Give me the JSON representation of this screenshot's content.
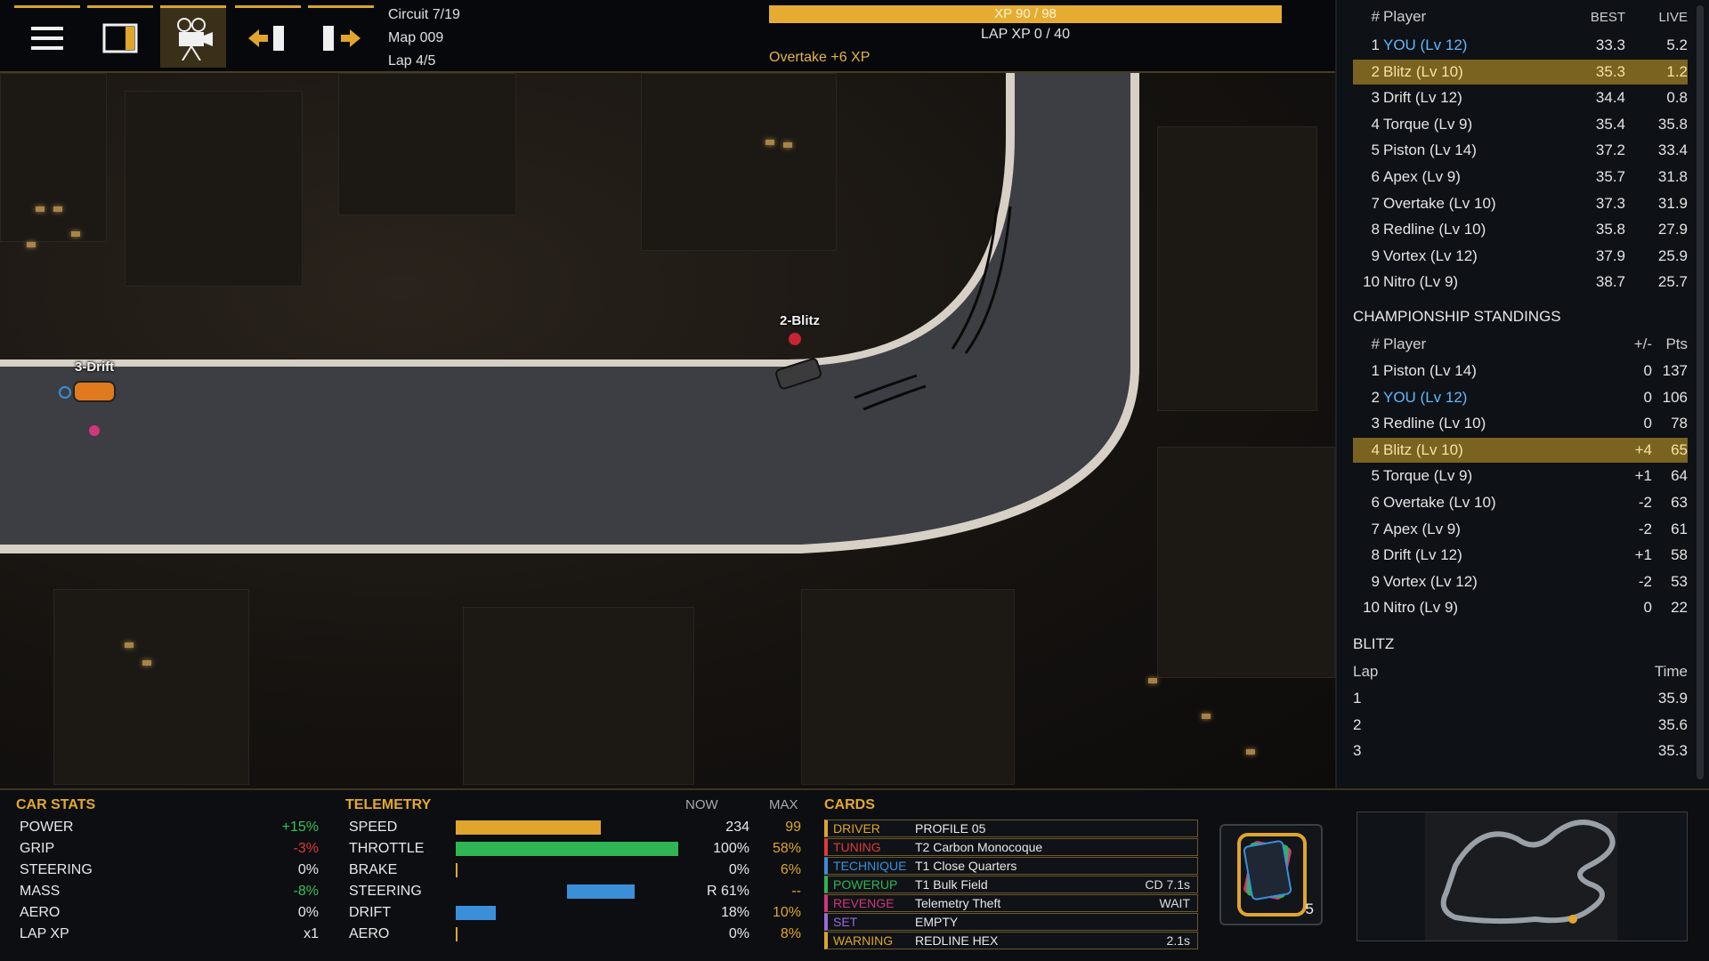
{
  "topbar": {
    "circuit": "Circuit 7/19",
    "map": "Map 009",
    "lap": "Lap 4/5",
    "xp_text": "XP 90 / 98",
    "lap_xp": "LAP XP 0 / 40",
    "event": "Overtake +6 XP",
    "buttons": [
      "menu-icon",
      "panel-toggle-icon",
      "camera-icon",
      "prev-icon",
      "next-icon"
    ]
  },
  "track_labels": {
    "blitz": "2-Blitz",
    "drift": "3-Drift"
  },
  "leaderboard": {
    "header": {
      "rank": "#",
      "player": "Player",
      "best": "BEST",
      "live": "LIVE"
    },
    "rows": [
      {
        "rank": "1",
        "name": "YOU (Lv 12)",
        "best": "33.3",
        "live": "5.2"
      },
      {
        "rank": "2",
        "name": "Blitz (Lv 10)",
        "best": "35.3",
        "live": "1.2"
      },
      {
        "rank": "3",
        "name": "Drift (Lv 12)",
        "best": "34.4",
        "live": "0.8"
      },
      {
        "rank": "4",
        "name": "Torque (Lv 9)",
        "best": "35.4",
        "live": "35.8"
      },
      {
        "rank": "5",
        "name": "Piston (Lv 14)",
        "best": "37.2",
        "live": "33.4"
      },
      {
        "rank": "6",
        "name": "Apex (Lv 9)",
        "best": "35.7",
        "live": "31.8"
      },
      {
        "rank": "7",
        "name": "Overtake (Lv 10)",
        "best": "37.3",
        "live": "31.9"
      },
      {
        "rank": "8",
        "name": "Redline (Lv 10)",
        "best": "35.8",
        "live": "27.9"
      },
      {
        "rank": "9",
        "name": "Vortex (Lv 12)",
        "best": "37.9",
        "live": "25.9"
      },
      {
        "rank": "10",
        "name": "Nitro (Lv 9)",
        "best": "38.7",
        "live": "25.7"
      }
    ]
  },
  "championship": {
    "title": "CHAMPIONSHIP STANDINGS",
    "header": {
      "rank": "#",
      "player": "Player",
      "delta": "+/-",
      "pts": "Pts"
    },
    "rows": [
      {
        "rank": "1",
        "name": "Piston (Lv 14)",
        "delta": "0",
        "pts": "137"
      },
      {
        "rank": "2",
        "name": "YOU (Lv 12)",
        "delta": "0",
        "pts": "106"
      },
      {
        "rank": "3",
        "name": "Redline (Lv 10)",
        "delta": "0",
        "pts": "78"
      },
      {
        "rank": "4",
        "name": "Blitz (Lv 10)",
        "delta": "+4",
        "pts": "65"
      },
      {
        "rank": "5",
        "name": "Torque (Lv 9)",
        "delta": "+1",
        "pts": "64"
      },
      {
        "rank": "6",
        "name": "Overtake (Lv 10)",
        "delta": "-2",
        "pts": "63"
      },
      {
        "rank": "7",
        "name": "Apex (Lv 9)",
        "delta": "-2",
        "pts": "61"
      },
      {
        "rank": "8",
        "name": "Drift (Lv 12)",
        "delta": "+1",
        "pts": "58"
      },
      {
        "rank": "9",
        "name": "Vortex (Lv 12)",
        "delta": "-2",
        "pts": "53"
      },
      {
        "rank": "10",
        "name": "Nitro (Lv 9)",
        "delta": "0",
        "pts": "22"
      }
    ]
  },
  "laps": {
    "title": "BLITZ",
    "header": {
      "lap": "Lap",
      "time": "Time"
    },
    "rows": [
      {
        "lap": "1",
        "time": "35.9"
      },
      {
        "lap": "2",
        "time": "35.6"
      },
      {
        "lap": "3",
        "time": "35.3"
      }
    ]
  },
  "car_stats": {
    "title": "CAR STATS",
    "rows": [
      {
        "label": "POWER",
        "value": "+15%",
        "tone": "green"
      },
      {
        "label": "GRIP",
        "value": "-3%",
        "tone": "red"
      },
      {
        "label": "STEERING",
        "value": "0%",
        "tone": "plain"
      },
      {
        "label": "MASS",
        "value": "-8%",
        "tone": "green"
      },
      {
        "label": "AERO",
        "value": "0%",
        "tone": "plain"
      },
      {
        "label": "LAP XP",
        "value": "x1",
        "tone": "plain"
      }
    ]
  },
  "telemetry": {
    "title": "TELEMETRY",
    "now_label": "NOW",
    "max_label": "MAX",
    "rows": [
      {
        "label": "SPEED",
        "now": "234",
        "max": "99",
        "fill": 0.65,
        "color": "#e0a52c"
      },
      {
        "label": "THROTTLE",
        "now": "100%",
        "max": "58%",
        "fill": 1.0,
        "color": "#2fb553"
      },
      {
        "label": "BRAKE",
        "now": "0%",
        "max": "6%",
        "fill": 0.0,
        "color": "#e0a52c"
      },
      {
        "label": "STEERING",
        "now": "R 61%",
        "max": "--",
        "fill": 0.61,
        "color": "#3a8fd8"
      },
      {
        "label": "DRIFT",
        "now": "18%",
        "max": "10%",
        "fill": 0.18,
        "color": "#3a8fd8"
      },
      {
        "label": "AERO",
        "now": "0%",
        "max": "8%",
        "fill": 0.0,
        "color": "#e0a52c"
      }
    ]
  },
  "cards": {
    "title": "CARDS",
    "deck_count": "5",
    "rows": [
      {
        "tag": "DRIVER",
        "value": "PROFILE 05",
        "extra": "",
        "color": "#e0a52c"
      },
      {
        "tag": "TUNING",
        "value": "T2 Carbon Monocoque",
        "extra": "",
        "color": "#e0393a"
      },
      {
        "tag": "TECHNIQUE",
        "value": "T1 Close Quarters",
        "extra": "",
        "color": "#3a8fd8"
      },
      {
        "tag": "POWERUP",
        "value": "T1 Bulk Field",
        "extra": "CD 7.1s",
        "color": "#2fb553"
      },
      {
        "tag": "REVENGE",
        "value": "Telemetry Theft",
        "extra": "WAIT",
        "color": "#d0367a"
      },
      {
        "tag": "SET",
        "value": "EMPTY",
        "extra": "",
        "color": "#9a6ad8"
      },
      {
        "tag": "WARNING",
        "value": "REDLINE HEX",
        "extra": "2.1s",
        "color": "#e0a52c"
      }
    ]
  }
}
